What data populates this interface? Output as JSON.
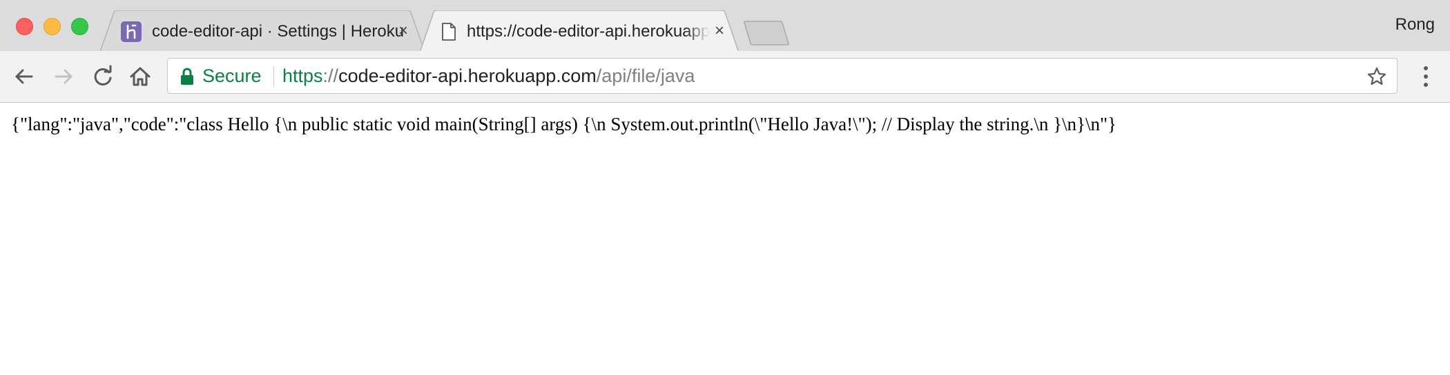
{
  "window": {
    "profile_name": "Rong"
  },
  "tabs": [
    {
      "title": "code-editor-api · Settings | Heroku",
      "icon": "heroku-icon",
      "active": false,
      "icon_color": "#7b68b5"
    },
    {
      "title": "https://code-editor-api.herokuapp.com/api/file/java",
      "icon": "page-icon",
      "active": true
    }
  ],
  "tab_close_glyph": "×",
  "toolbar": {
    "secure_label": "Secure",
    "url": {
      "scheme": "https",
      "separator": "://",
      "host": "code-editor-api.herokuapp.com",
      "path": "/api/file/java"
    }
  },
  "page": {
    "body_text": "{\"lang\":\"java\",\"code\":\"class Hello {\\n public static void main(String[] args) {\\n System.out.println(\\\"Hello Java!\\\"); // Display the string.\\n }\\n}\\n\"}"
  },
  "colors": {
    "secure_green": "#0b8043",
    "titlebar_bg": "#dcdcdc",
    "toolbar_bg": "#f2f2f2"
  }
}
